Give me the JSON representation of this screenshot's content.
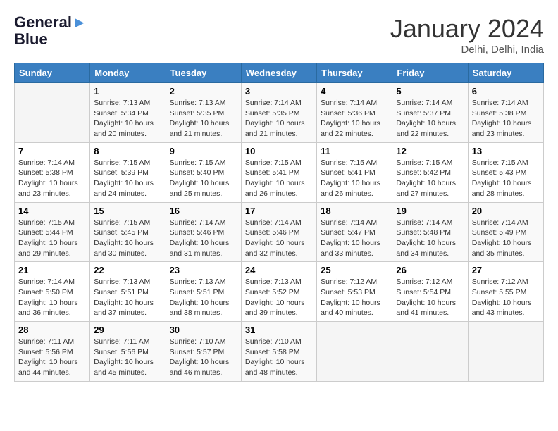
{
  "header": {
    "logo_line1": "General",
    "logo_line2": "Blue",
    "month_title": "January 2024",
    "location": "Delhi, Delhi, India"
  },
  "days_of_week": [
    "Sunday",
    "Monday",
    "Tuesday",
    "Wednesday",
    "Thursday",
    "Friday",
    "Saturday"
  ],
  "weeks": [
    [
      {
        "day": "",
        "sunrise": "",
        "sunset": "",
        "daylight": ""
      },
      {
        "day": "1",
        "sunrise": "Sunrise: 7:13 AM",
        "sunset": "Sunset: 5:34 PM",
        "daylight": "Daylight: 10 hours and 20 minutes."
      },
      {
        "day": "2",
        "sunrise": "Sunrise: 7:13 AM",
        "sunset": "Sunset: 5:35 PM",
        "daylight": "Daylight: 10 hours and 21 minutes."
      },
      {
        "day": "3",
        "sunrise": "Sunrise: 7:14 AM",
        "sunset": "Sunset: 5:35 PM",
        "daylight": "Daylight: 10 hours and 21 minutes."
      },
      {
        "day": "4",
        "sunrise": "Sunrise: 7:14 AM",
        "sunset": "Sunset: 5:36 PM",
        "daylight": "Daylight: 10 hours and 22 minutes."
      },
      {
        "day": "5",
        "sunrise": "Sunrise: 7:14 AM",
        "sunset": "Sunset: 5:37 PM",
        "daylight": "Daylight: 10 hours and 22 minutes."
      },
      {
        "day": "6",
        "sunrise": "Sunrise: 7:14 AM",
        "sunset": "Sunset: 5:38 PM",
        "daylight": "Daylight: 10 hours and 23 minutes."
      }
    ],
    [
      {
        "day": "7",
        "sunrise": "Sunrise: 7:14 AM",
        "sunset": "Sunset: 5:38 PM",
        "daylight": "Daylight: 10 hours and 23 minutes."
      },
      {
        "day": "8",
        "sunrise": "Sunrise: 7:15 AM",
        "sunset": "Sunset: 5:39 PM",
        "daylight": "Daylight: 10 hours and 24 minutes."
      },
      {
        "day": "9",
        "sunrise": "Sunrise: 7:15 AM",
        "sunset": "Sunset: 5:40 PM",
        "daylight": "Daylight: 10 hours and 25 minutes."
      },
      {
        "day": "10",
        "sunrise": "Sunrise: 7:15 AM",
        "sunset": "Sunset: 5:41 PM",
        "daylight": "Daylight: 10 hours and 26 minutes."
      },
      {
        "day": "11",
        "sunrise": "Sunrise: 7:15 AM",
        "sunset": "Sunset: 5:41 PM",
        "daylight": "Daylight: 10 hours and 26 minutes."
      },
      {
        "day": "12",
        "sunrise": "Sunrise: 7:15 AM",
        "sunset": "Sunset: 5:42 PM",
        "daylight": "Daylight: 10 hours and 27 minutes."
      },
      {
        "day": "13",
        "sunrise": "Sunrise: 7:15 AM",
        "sunset": "Sunset: 5:43 PM",
        "daylight": "Daylight: 10 hours and 28 minutes."
      }
    ],
    [
      {
        "day": "14",
        "sunrise": "Sunrise: 7:15 AM",
        "sunset": "Sunset: 5:44 PM",
        "daylight": "Daylight: 10 hours and 29 minutes."
      },
      {
        "day": "15",
        "sunrise": "Sunrise: 7:15 AM",
        "sunset": "Sunset: 5:45 PM",
        "daylight": "Daylight: 10 hours and 30 minutes."
      },
      {
        "day": "16",
        "sunrise": "Sunrise: 7:14 AM",
        "sunset": "Sunset: 5:46 PM",
        "daylight": "Daylight: 10 hours and 31 minutes."
      },
      {
        "day": "17",
        "sunrise": "Sunrise: 7:14 AM",
        "sunset": "Sunset: 5:46 PM",
        "daylight": "Daylight: 10 hours and 32 minutes."
      },
      {
        "day": "18",
        "sunrise": "Sunrise: 7:14 AM",
        "sunset": "Sunset: 5:47 PM",
        "daylight": "Daylight: 10 hours and 33 minutes."
      },
      {
        "day": "19",
        "sunrise": "Sunrise: 7:14 AM",
        "sunset": "Sunset: 5:48 PM",
        "daylight": "Daylight: 10 hours and 34 minutes."
      },
      {
        "day": "20",
        "sunrise": "Sunrise: 7:14 AM",
        "sunset": "Sunset: 5:49 PM",
        "daylight": "Daylight: 10 hours and 35 minutes."
      }
    ],
    [
      {
        "day": "21",
        "sunrise": "Sunrise: 7:14 AM",
        "sunset": "Sunset: 5:50 PM",
        "daylight": "Daylight: 10 hours and 36 minutes."
      },
      {
        "day": "22",
        "sunrise": "Sunrise: 7:13 AM",
        "sunset": "Sunset: 5:51 PM",
        "daylight": "Daylight: 10 hours and 37 minutes."
      },
      {
        "day": "23",
        "sunrise": "Sunrise: 7:13 AM",
        "sunset": "Sunset: 5:51 PM",
        "daylight": "Daylight: 10 hours and 38 minutes."
      },
      {
        "day": "24",
        "sunrise": "Sunrise: 7:13 AM",
        "sunset": "Sunset: 5:52 PM",
        "daylight": "Daylight: 10 hours and 39 minutes."
      },
      {
        "day": "25",
        "sunrise": "Sunrise: 7:12 AM",
        "sunset": "Sunset: 5:53 PM",
        "daylight": "Daylight: 10 hours and 40 minutes."
      },
      {
        "day": "26",
        "sunrise": "Sunrise: 7:12 AM",
        "sunset": "Sunset: 5:54 PM",
        "daylight": "Daylight: 10 hours and 41 minutes."
      },
      {
        "day": "27",
        "sunrise": "Sunrise: 7:12 AM",
        "sunset": "Sunset: 5:55 PM",
        "daylight": "Daylight: 10 hours and 43 minutes."
      }
    ],
    [
      {
        "day": "28",
        "sunrise": "Sunrise: 7:11 AM",
        "sunset": "Sunset: 5:56 PM",
        "daylight": "Daylight: 10 hours and 44 minutes."
      },
      {
        "day": "29",
        "sunrise": "Sunrise: 7:11 AM",
        "sunset": "Sunset: 5:56 PM",
        "daylight": "Daylight: 10 hours and 45 minutes."
      },
      {
        "day": "30",
        "sunrise": "Sunrise: 7:10 AM",
        "sunset": "Sunset: 5:57 PM",
        "daylight": "Daylight: 10 hours and 46 minutes."
      },
      {
        "day": "31",
        "sunrise": "Sunrise: 7:10 AM",
        "sunset": "Sunset: 5:58 PM",
        "daylight": "Daylight: 10 hours and 48 minutes."
      },
      {
        "day": "",
        "sunrise": "",
        "sunset": "",
        "daylight": ""
      },
      {
        "day": "",
        "sunrise": "",
        "sunset": "",
        "daylight": ""
      },
      {
        "day": "",
        "sunrise": "",
        "sunset": "",
        "daylight": ""
      }
    ]
  ]
}
